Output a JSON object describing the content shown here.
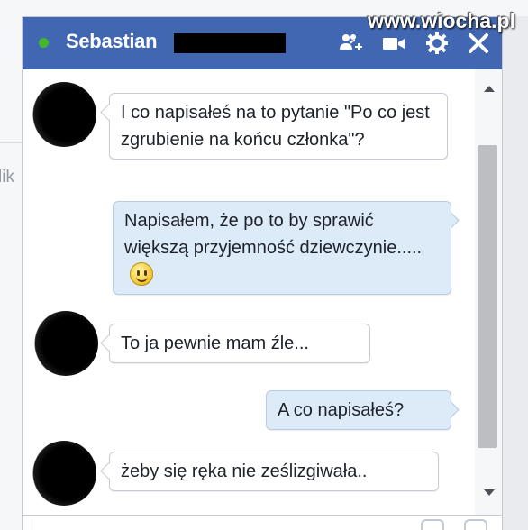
{
  "watermark": "www.wiocha.pl",
  "background_fragment": "lik",
  "chat": {
    "contact_name": "Sebastian",
    "presence_color": "#42b72a",
    "header_color": "#4267b2",
    "header_icons": [
      "add-user-icon",
      "video-call-icon",
      "gear-icon",
      "close-icon"
    ]
  },
  "messages": [
    {
      "direction": "incoming",
      "text": "I co napisałeś na to pytanie \"Po co jest zgrubienie na końcu członka\"?"
    },
    {
      "direction": "outgoing",
      "text": "Napisałem, że po to by sprawić większą przyjemność dziewczynie.....",
      "emoji": "smiley-icon"
    },
    {
      "direction": "incoming",
      "text": "To ja pewnie mam źle..."
    },
    {
      "direction": "outgoing",
      "text": "A co napisałeś?"
    },
    {
      "direction": "incoming",
      "text": "żeby się ręka nie ześlizgiwała.."
    }
  ]
}
